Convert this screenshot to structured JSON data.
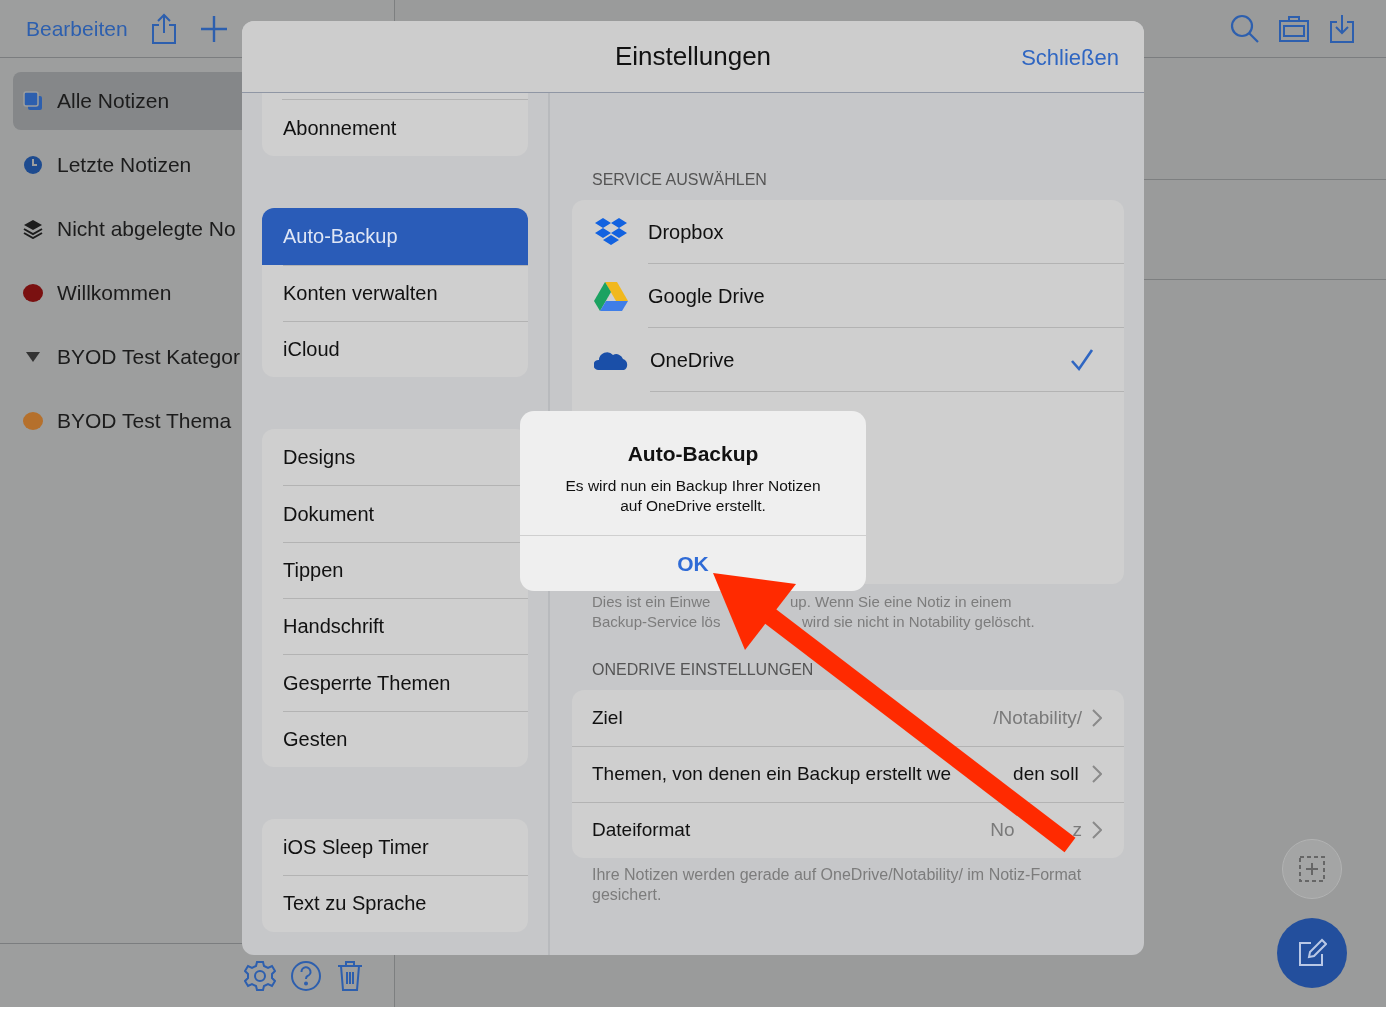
{
  "toolbar": {
    "edit_label": "Bearbeiten"
  },
  "sidebar": {
    "items": [
      {
        "label": "Alle Notizen",
        "kind": "notes",
        "selected": true
      },
      {
        "label": "Letzte Notizen",
        "kind": "recent",
        "selected": false
      },
      {
        "label": "Nicht abgelegte No",
        "kind": "unfiled",
        "selected": false
      },
      {
        "label": "Willkommen",
        "kind": "dot",
        "color": "#7a1010",
        "selected": false
      },
      {
        "label": "BYOD Test Kategor",
        "kind": "category",
        "expanded": true,
        "selected": false
      },
      {
        "label": "BYOD Test Thema",
        "kind": "dot",
        "color": "#b5702c",
        "selected": false
      }
    ]
  },
  "settings": {
    "title": "Einstellungen",
    "close": "Schließen",
    "menu_groups": [
      [
        {
          "label": "Abonnement",
          "selected": false
        }
      ],
      [
        {
          "label": "Auto-Backup",
          "selected": true
        },
        {
          "label": "Konten verwalten",
          "selected": false
        },
        {
          "label": "iCloud",
          "selected": false
        }
      ],
      [
        {
          "label": "Designs",
          "selected": false
        },
        {
          "label": "Dokument",
          "selected": false
        },
        {
          "label": "Tippen",
          "selected": false
        },
        {
          "label": "Handschrift",
          "selected": false
        },
        {
          "label": "Gesperrte Themen",
          "selected": false
        },
        {
          "label": "Gesten",
          "selected": false
        }
      ],
      [
        {
          "label": "iOS Sleep Timer",
          "selected": false
        },
        {
          "label": "Text zu Sprache",
          "selected": false
        }
      ]
    ],
    "service_header": "SERVICE AUSWÄHLEN",
    "services": [
      {
        "name": "Dropbox",
        "kind": "dropbox",
        "checked": false
      },
      {
        "name": "Google Drive",
        "kind": "gdrive",
        "checked": false
      },
      {
        "name": "OneDrive",
        "kind": "onedrive",
        "checked": true
      }
    ],
    "service_footer": [
      [
        "Dies ist ein Einwe",
        "up. Wenn Sie eine Notiz in einem"
      ],
      [
        "Backup-Service lös",
        "wird sie nicht in Notability gelöscht."
      ]
    ],
    "onedrive_header": "ONEDRIVE EINSTELLUNGEN",
    "onedrive_rows": [
      {
        "label": [
          "Ziel"
        ],
        "value": [
          "/Notability/"
        ]
      },
      {
        "label": [
          "Themen, von denen ein Backup erstellt we",
          "den soll"
        ]
      },
      {
        "label": [
          "Dateiformat"
        ],
        "value": [
          "No",
          "z"
        ]
      }
    ],
    "onedrive_footer": "Ihre Notizen werden gerade auf OneDrive/Notability/ im Notiz-Format gesichert."
  },
  "alert": {
    "title": "Auto-Backup",
    "message": "Es wird nun ein Backup Ihrer Notizen auf OneDrive erstellt.",
    "button": "OK"
  }
}
